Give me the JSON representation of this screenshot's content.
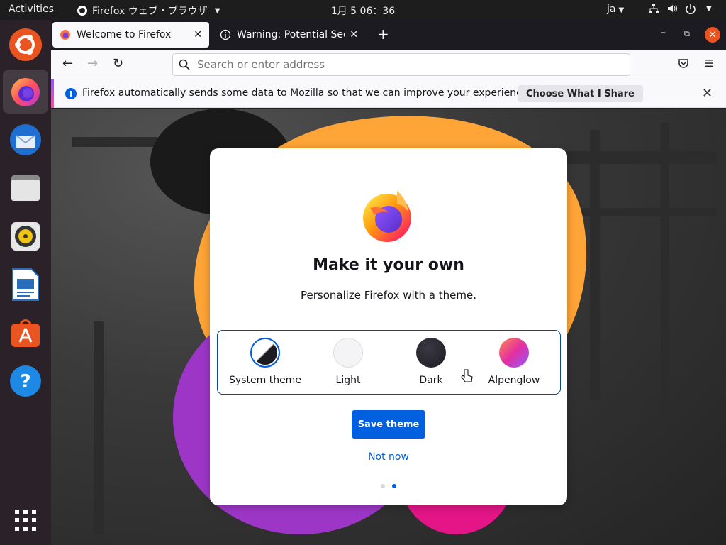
{
  "topbar": {
    "activities": "Activities",
    "app_name": "Firefox ウェブ・ブラウザ",
    "clock": "1月 5 06：36",
    "language": "ja"
  },
  "dock": {
    "items": [
      "ubuntu",
      "firefox",
      "thunderbird",
      "files",
      "rhythmbox",
      "writer",
      "software",
      "help",
      "app-grid"
    ]
  },
  "tabs": [
    {
      "title": "Welcome to Firefox",
      "active": true
    },
    {
      "title": "Warning: Potential Securi",
      "active": false
    }
  ],
  "navbar": {
    "search_placeholder": "Search or enter address"
  },
  "notification": {
    "message": "Firefox automatically sends some data to Mozilla so that we can improve your experience.",
    "button": "Choose What I Share"
  },
  "card": {
    "title": "Make it your own",
    "subtitle": "Personalize Firefox with a theme.",
    "themes": [
      {
        "label": "System theme",
        "selected": true
      },
      {
        "label": "Light",
        "selected": false
      },
      {
        "label": "Dark",
        "selected": false
      },
      {
        "label": "Alpenglow",
        "selected": false
      }
    ],
    "save_label": "Save theme",
    "not_now_label": "Not now",
    "step_current": 2,
    "step_total": 2
  },
  "colors": {
    "accent": "#0060df",
    "ubuntu_orange": "#e95420",
    "dock_bg": "#2b2229",
    "tab_bg": "#1c1b22"
  }
}
